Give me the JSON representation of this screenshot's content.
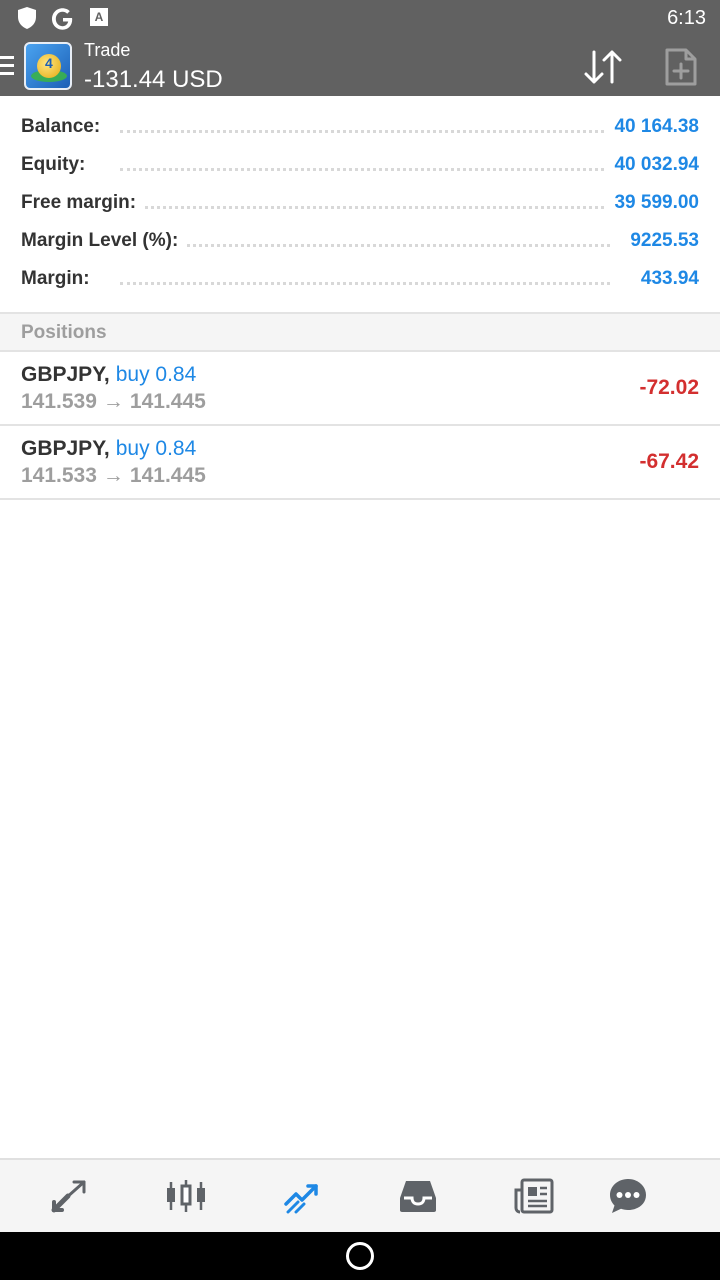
{
  "status_bar": {
    "time": "6:13",
    "icons": [
      "shield-icon",
      "google-icon",
      "keyboard-icon"
    ]
  },
  "app_bar": {
    "title": "Trade",
    "subtitle": "-131.44 USD",
    "icons": [
      "menu-icon",
      "app-logo-icon",
      "sort-icon",
      "new-order-icon"
    ]
  },
  "summary": [
    {
      "label": "Balance:",
      "value": "40 164.38"
    },
    {
      "label": "Equity:",
      "value": "40 032.94"
    },
    {
      "label": "Free margin:",
      "value": "39 599.00"
    },
    {
      "label": "Margin Level (%):",
      "value": "9225.53"
    },
    {
      "label": "Margin:",
      "value": "433.94"
    }
  ],
  "positions": {
    "header": "Positions",
    "items": [
      {
        "symbol": "GBPJPY",
        "separator": ",",
        "side": "buy 0.84",
        "open_price": "141.539",
        "arrow": "→",
        "current_price": "141.445",
        "profit": "-72.02"
      },
      {
        "symbol": "GBPJPY",
        "separator": ",",
        "side": "buy 0.84",
        "open_price": "141.533",
        "arrow": "→",
        "current_price": "141.445",
        "profit": "-67.42"
      }
    ]
  },
  "bottom_nav": {
    "items": [
      {
        "icon": "quotes-icon",
        "active": false
      },
      {
        "icon": "chart-icon",
        "active": false
      },
      {
        "icon": "trade-icon",
        "active": true
      },
      {
        "icon": "history-icon",
        "active": false
      },
      {
        "icon": "news-icon",
        "active": false
      },
      {
        "icon": "messages-icon",
        "active": false
      }
    ]
  },
  "colors": {
    "app_bar": "#616161",
    "accent_blue": "#1e88e5",
    "loss_red": "#d32f2f",
    "muted_gray": "#9e9e9e",
    "icon_gray": "#5f6368"
  }
}
